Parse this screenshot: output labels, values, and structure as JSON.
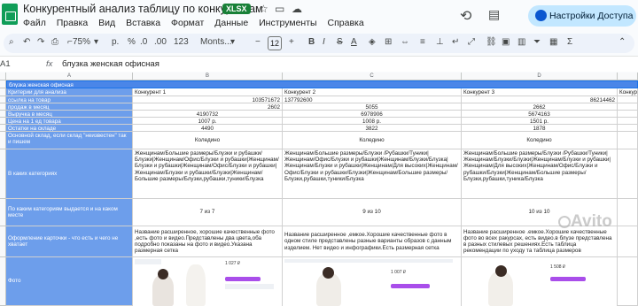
{
  "window": {
    "title": "Конкурентный анализ таблицу по конкурентам",
    "file_badge": "XLSX",
    "share_label": "Настройки Доступа"
  },
  "menu": [
    "Файл",
    "Правка",
    "Вид",
    "Вставка",
    "Формат",
    "Данные",
    "Инструменты",
    "Справка"
  ],
  "toolbar": {
    "zoom": "75%",
    "currency": "р.",
    "percent": "%",
    "dec_less": ".0",
    "dec_more": ".00",
    "num_format": "123",
    "font": "Monts...",
    "font_size": "12",
    "bold": "B",
    "italic": "I",
    "strike": "S",
    "text_color": "A"
  },
  "formula_bar": {
    "cell_ref": "A1",
    "fx": "fx",
    "content": "блузка женская офисная"
  },
  "columns": [
    "A",
    "B",
    "C",
    "D"
  ],
  "rows": {
    "header": "блузка женская офисная",
    "criteria_label": "Критерии для анализа",
    "competitors": [
      "Конкурент 1",
      "Конкурент 2",
      "Конкурент 3",
      "Конкурент"
    ],
    "link_label": "ссылка на товар",
    "links": [
      "103571672",
      "137792600",
      "86214462"
    ],
    "sales_label": "продаж в месяц",
    "sales": [
      "2602",
      "5055",
      "2662"
    ],
    "revenue_label": "Выручка в месяц",
    "revenue": [
      "4190732",
      "6978906",
      "5674163"
    ],
    "price_label": "Цена на 1 ед товара",
    "price": [
      "1007 р.",
      "1008 р.",
      "1501 р."
    ],
    "stock_label": "Остатки на складе",
    "stock": [
      "4490",
      "3822",
      "1878"
    ],
    "warehouse_label": "Основной склад, если склад \"неизвестен\" так и пишем",
    "warehouse": [
      "Коледино",
      "Коледино",
      "Коледино"
    ],
    "categories_label": "В каких категориях",
    "categories": [
      "Женщинам/Большие размеры/Блузки и рубашки/Блузки|Женщинам/Офис/Блузки и рубашки|Женщинам/Блузки и рубашки|Женщинам/Офис/Блузки и рубашки|Женщинам/Блузки и рубашки/Блузки|Женщинам/Большие размеры/Блузки,рубашки,туники/Блузка",
      "Женщинам/Большие размеры/Блузки /Рубашки/Туники|Женщинам/Офис/Блузки и рубашки|Женщинам/Блузки/Блузка|Женщинам/Блузки и рубашки|Женщинам/Для высоких|Женщинам/Офис/Блузки и рубашки/Блузки|Женщинам/Большие размеры/Блузки,рубашки,туники/Блузка",
      "Женщинам/Большие размеры/Блузки /Рубашки/Туники|Женщинам/Блузки/Блузки|Женщинам/Блузки и рубашки|Женщинам/Для высоких|Женщинам/Офис/Блузки и рубашки/Блузки|Женщинам/Большие размеры/Блузки,рубашки,туника/Блузка"
    ],
    "position_label": "По каким категориям выдается и на каком месте",
    "position": [
      "7 из 7",
      "9 из 10",
      "10 из 10"
    ],
    "design_label": "Оформление карточки - что есть и чего не хватает",
    "design": [
      "Название расширенное, хорошие качественные фото ,есть фото и видео.Представлены два цвета,оба подробно показаны на фото и видео.Указана размерная сетка",
      "Название расширенное ,емкое.Хорошие качественные фото в одном стиле представлены разные варианты образов с данным изделием. Нет видео и инфографики.Есть размерная сетка",
      "Название расширенное .емкое.Хорошие качественные фото во всех ракурсах, есть видео.в блузе представлена в разных стилевых решениях.Есть таблица рекомендации по уходу та таблица размеров"
    ],
    "photo_label": "Фото",
    "photo_prices": [
      "1 027 ₽",
      "1 007 ₽",
      "1 508 ₽"
    ]
  },
  "watermark": "Avito"
}
